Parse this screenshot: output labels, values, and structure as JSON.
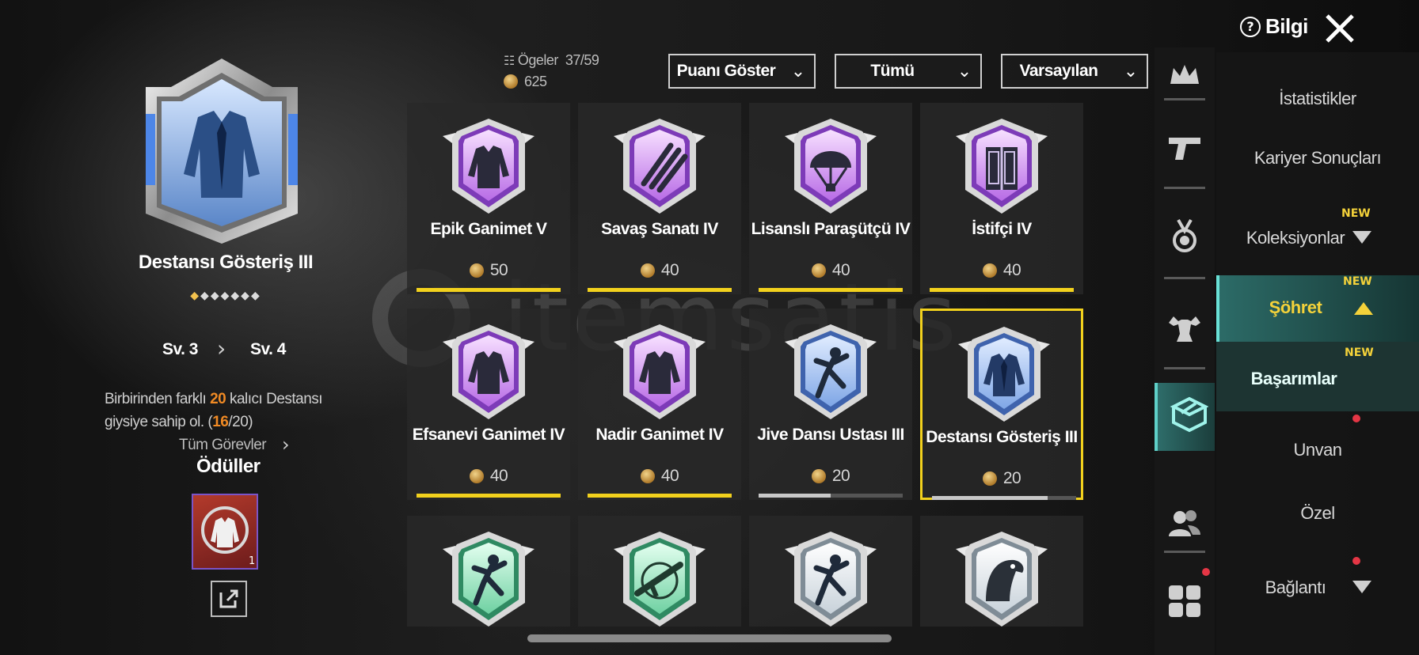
{
  "header": {
    "info_label": "Bilgi",
    "items_label": "Ögeler",
    "items_count": "37/59",
    "points_total": "625"
  },
  "filters": {
    "points": "Puanı Göster",
    "all": "Tümü",
    "sort": "Varsayılan"
  },
  "selected": {
    "name": "Destansı Gösteriş III",
    "level_current": "Sv. 3",
    "level_next": "Sv. 4",
    "stars_filled": 1,
    "stars_total": 7,
    "desc_part1": "Birbirinden farklı ",
    "desc_num": "20",
    "desc_part2": " kalıcı Destansı giysiye sahip ol. (",
    "desc_progress": "16",
    "desc_part3": "/20)",
    "all_tasks": "Tüm Görevler",
    "rewards_title": "Ödüller",
    "reward_count": "1"
  },
  "tiles": [
    {
      "name": "Epik Ganimet V",
      "points": "50",
      "progress": 1.0,
      "tier": "epic",
      "icon": "jacket-icon"
    },
    {
      "name": "Savaş Sanatı IV",
      "points": "40",
      "progress": 1.0,
      "tier": "epic",
      "icon": "claw-icon"
    },
    {
      "name": "Lisanslı Paraşütçü IV",
      "points": "40",
      "progress": 1.0,
      "tier": "epic",
      "icon": "parachute-icon"
    },
    {
      "name": "İstifçi IV",
      "points": "40",
      "progress": 1.0,
      "tier": "epic",
      "icon": "locker-icon"
    },
    {
      "name": "Efsanevi Ganimet IV",
      "points": "40",
      "progress": 1.0,
      "tier": "epic",
      "icon": "jacket-icon"
    },
    {
      "name": "Nadir Ganimet IV",
      "points": "40",
      "progress": 1.0,
      "tier": "epic",
      "icon": "jacket-icon"
    },
    {
      "name": "Jive Dansı Ustası III",
      "points": "20",
      "progress": 0.5,
      "tier": "rare",
      "icon": "dancer-icon"
    },
    {
      "name": "Destansı Gösteriş III",
      "points": "20",
      "progress": 0.8,
      "tier": "rare",
      "icon": "suit-icon"
    }
  ],
  "partial_tiles": [
    {
      "tier": "green",
      "icon": "dancer-icon"
    },
    {
      "tier": "green",
      "icon": "rifle-icon"
    },
    {
      "tier": "silver",
      "icon": "dancer-icon"
    },
    {
      "tier": "silver",
      "icon": "eagle-icon"
    }
  ],
  "menu": {
    "stats": "İstatistikler",
    "career": "Kariyer Sonuçları",
    "collections": "Koleksiyonlar",
    "fame": "Şöhret",
    "achievements": "Başarımlar",
    "title": "Unvan",
    "special": "Özel",
    "connection": "Bağlantı",
    "new_label": "NEW"
  },
  "colors": {
    "accent_gold": "#f4d23a",
    "accent_teal": "#5fd0c8",
    "progress_yellow": "#f2d11d",
    "progress_gray": "#c8c8c8",
    "highlight_orange": "#f08a24"
  }
}
